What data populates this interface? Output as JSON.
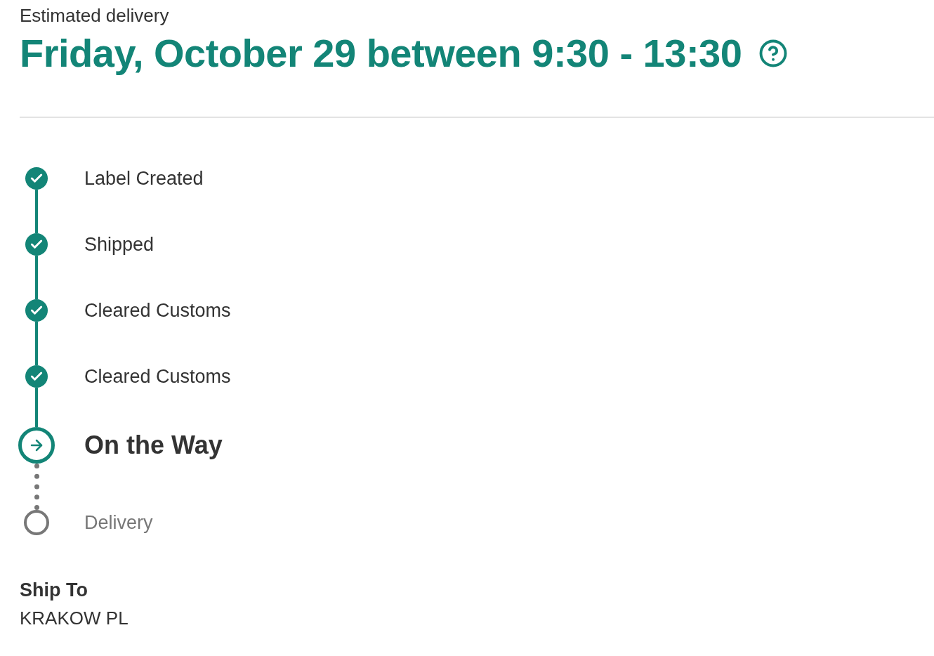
{
  "header": {
    "label": "Estimated delivery",
    "title": "Friday, October 29 between 9:30 - 13:30"
  },
  "steps": [
    {
      "label": "Label Created",
      "kind": "done"
    },
    {
      "label": "Shipped",
      "kind": "done"
    },
    {
      "label": "Cleared Customs",
      "kind": "done"
    },
    {
      "label": "Cleared Customs",
      "kind": "done"
    },
    {
      "label": "On the Way",
      "kind": "current"
    },
    {
      "label": "Delivery",
      "kind": "pending"
    }
  ],
  "ship_to": {
    "label": "Ship To",
    "value": "KRAKOW PL"
  }
}
